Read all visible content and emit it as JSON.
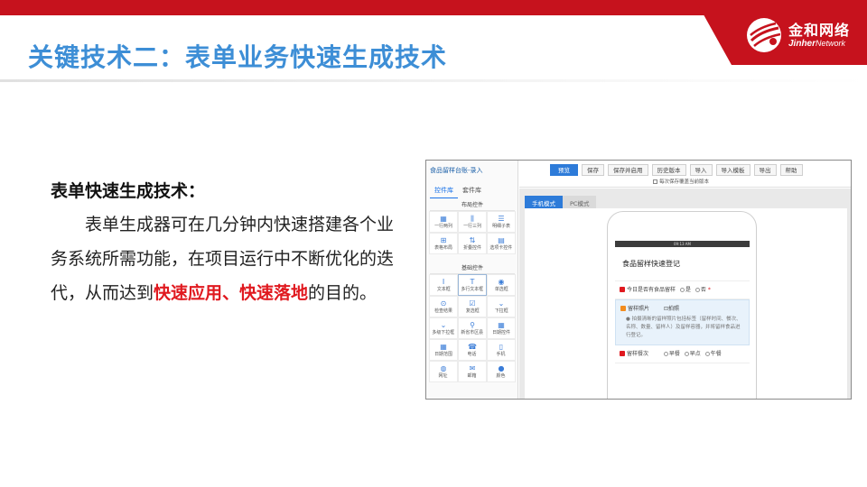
{
  "header": {
    "title": "关键技术二：表单业务快速生成技术",
    "logo_cn": "金和网络",
    "logo_en_bold": "Jinher",
    "logo_en_rest": "Network",
    "brand_red": "#c6121d",
    "title_blue": "#3d8ed6"
  },
  "content": {
    "heading": "表单快速生成技术：",
    "body_lead": "表单生成器可在几分钟内快速搭建各个业务系统所需功能，在项目运行中不断优化的迭代，从而达到",
    "body_highlight": "快速应用、快速落地",
    "body_tail": "的目的。",
    "highlight_color": "#e0191f"
  },
  "app": {
    "window_title": "食品留样台账-录入",
    "sidebar_tabs": [
      "控件库",
      "套件库"
    ],
    "layout_group": "布局控件",
    "layout_controls": [
      {
        "icon": "grid-icon",
        "glyph": "▦",
        "label": "一行两列"
      },
      {
        "icon": "columns-icon",
        "glyph": "⫼",
        "label": "一行三列"
      },
      {
        "icon": "subtable-icon",
        "glyph": "☰",
        "label": "明细子表"
      },
      {
        "icon": "table-layout-icon",
        "glyph": "⊞",
        "label": "表格布局"
      },
      {
        "icon": "fold-icon",
        "glyph": "⇅",
        "label": "折叠控件"
      },
      {
        "icon": "tabs-icon",
        "glyph": "▤",
        "label": "选项卡控件"
      }
    ],
    "basic_group": "基础控件",
    "basic_controls": [
      {
        "icon": "text-icon",
        "glyph": "I",
        "label": "文本框"
      },
      {
        "icon": "multiline-text-icon",
        "glyph": "T",
        "label": "多行文本框"
      },
      {
        "icon": "radio-icon",
        "glyph": "◉",
        "label": "单选框"
      },
      {
        "icon": "check-result-icon",
        "glyph": "⊙",
        "label": "检查结果"
      },
      {
        "icon": "checkbox-icon",
        "glyph": "☑",
        "label": "复选框"
      },
      {
        "icon": "dropdown-icon",
        "glyph": "⌄",
        "label": "下拉框"
      },
      {
        "icon": "multi-dropdown-icon",
        "glyph": "⌄",
        "label": "多级下拉框"
      },
      {
        "icon": "location-icon",
        "glyph": "⚲",
        "label": "新省市区县"
      },
      {
        "icon": "date-icon",
        "glyph": "▦",
        "label": "日期控件"
      },
      {
        "icon": "date-range-icon",
        "glyph": "▦",
        "label": "日期范围"
      },
      {
        "icon": "phone-icon",
        "glyph": "☎",
        "label": "电话"
      },
      {
        "icon": "mobile-icon",
        "glyph": "▯",
        "label": "手机"
      },
      {
        "icon": "globe-icon",
        "glyph": "◍",
        "label": "网址"
      },
      {
        "icon": "mail-icon",
        "glyph": "✉",
        "label": "邮箱"
      },
      {
        "icon": "color-icon",
        "glyph": "●",
        "label": "颜色"
      }
    ],
    "toolbar": [
      "预览",
      "保存",
      "保存并启用",
      "历史版本",
      "导入",
      "导入模板",
      "导出",
      "帮助"
    ],
    "autosave_label": "每次保存覆盖当前版本",
    "mode_tabs": [
      "手机模式",
      "PC模式"
    ],
    "phone_status": "09:13 AM",
    "form": {
      "title": "食品留样快速登记",
      "q1_label": "今日是否有食品留样",
      "q1_required": "*",
      "q1_yes": "是",
      "q1_no": "否",
      "q2_label": "留样照片",
      "q2_action": "拍照",
      "q2_hint": "拍摄清晰的留样照片包括标签（留样时间、餐次、名称、数量、留样人）及留样容器，并将留样食品进行登记。",
      "q3_label": "留样餐次",
      "q3_options": [
        "早餐",
        "早点",
        "午餐"
      ]
    }
  }
}
